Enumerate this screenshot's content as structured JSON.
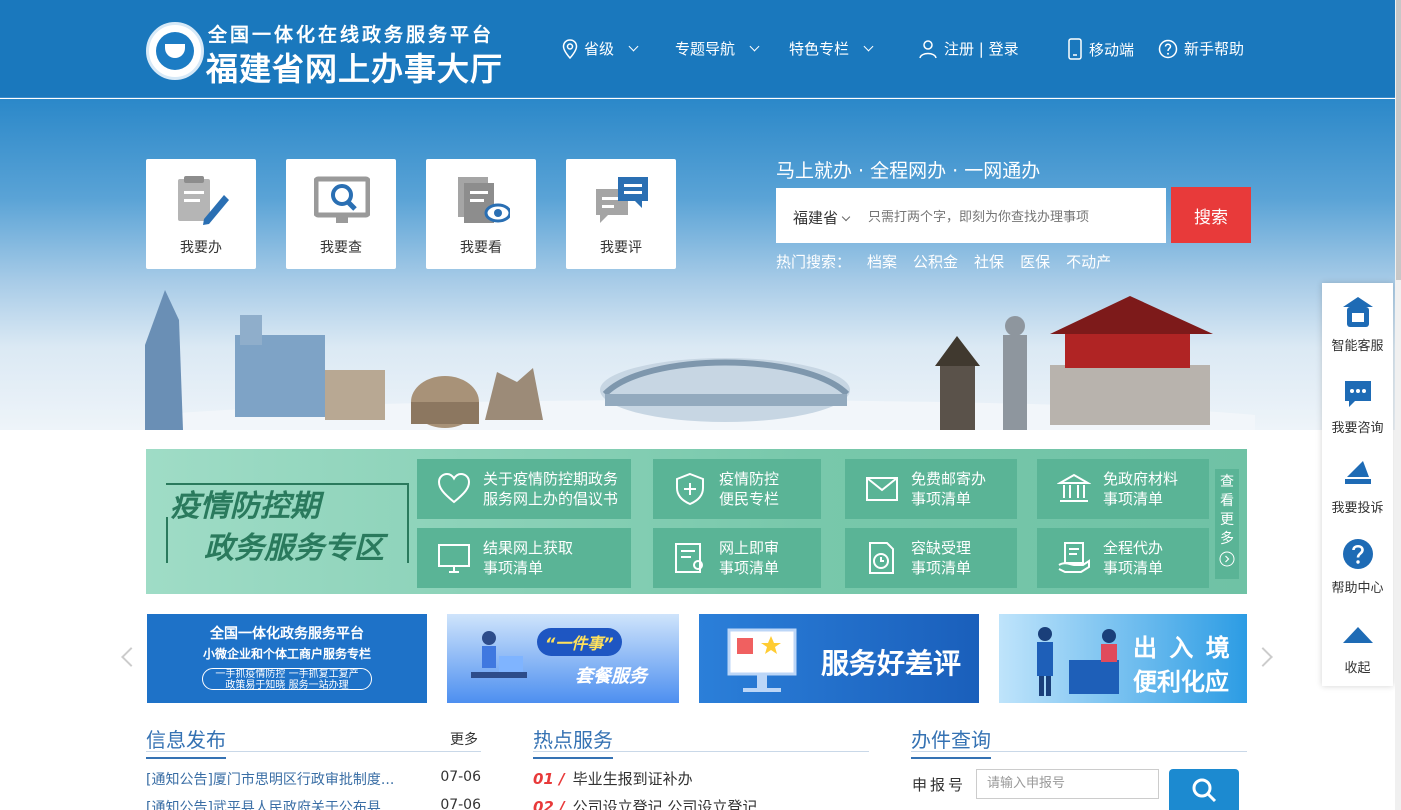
{
  "header": {
    "brand_sub": "全国一体化在线政务服务平台",
    "brand_main": "福建省网上办事大厅",
    "nav": {
      "province": "省级",
      "topics": "专题导航",
      "special": "特色专栏",
      "register_login": "注册 | 登录",
      "mobile": "移动端",
      "help": "新手帮助"
    }
  },
  "hero": {
    "tiles": [
      "我要办",
      "我要查",
      "我要看",
      "我要评"
    ],
    "slogan": "马上就办 · 全程网办 · 一网通办",
    "search": {
      "province": "福建省",
      "placeholder": "只需打两个字，即刻为你查找办理事项",
      "button": "搜索"
    },
    "hot_label": "热门搜索：",
    "hot_terms": [
      "档案",
      "公积金",
      "社保",
      "医保",
      "不动产"
    ]
  },
  "covid": {
    "title1": "疫情防控期",
    "title2": "政务服务专区",
    "items": [
      {
        "line1": "关于疫情防控期政务",
        "line2": "服务网上办的倡议书"
      },
      {
        "line1": "疫情防控",
        "line2": "便民专栏"
      },
      {
        "line1": "免费邮寄办",
        "line2": "事项清单"
      },
      {
        "line1": "免政府材料",
        "line2": "事项清单"
      },
      {
        "line1": "结果网上获取",
        "line2": "事项清单"
      },
      {
        "line1": "网上即审",
        "line2": "事项清单"
      },
      {
        "line1": "容缺受理",
        "line2": "事项清单"
      },
      {
        "line1": "全程代办",
        "line2": "事项清单"
      }
    ],
    "more": [
      "查",
      "看",
      "更",
      "多"
    ]
  },
  "banners": {
    "b1": {
      "line1": "全国一体化政务服务平台",
      "line2": "小微企业和个体工商户服务专栏",
      "line3": "一手抓疫情防控 一手抓复工复产",
      "line4": "政策易于知晓 服务一站办理"
    },
    "b2": {
      "line1": "“一件事”",
      "line2": "套餐服务"
    },
    "b3": {
      "line1": "服务好差评"
    },
    "b4": {
      "line1": "出 入 境",
      "line2": "便利化应用"
    }
  },
  "info": {
    "title": "信息发布",
    "more": "更多",
    "items": [
      {
        "text": "[通知公告]厦门市思明区行政审批制度...",
        "date": "07-06"
      },
      {
        "text": "[通知公告]武平县人民政府关于公布县...",
        "date": "07-06"
      }
    ]
  },
  "hot_services": {
    "title": "热点服务",
    "items": [
      {
        "num": "01 /",
        "text": "毕业生报到证补办"
      },
      {
        "num": "02 /",
        "text": "公司设立登记  公司设立登记"
      }
    ]
  },
  "query": {
    "title": "办件查询",
    "label": "申报号",
    "placeholder": "请输入申报号"
  },
  "float_bar": [
    "智能客服",
    "我要咨询",
    "我要投诉",
    "帮助中心",
    "收起"
  ],
  "colors": {
    "header_blue": "#1a78bd",
    "search_red": "#e83a3a",
    "covid_green": "#5ab496",
    "section_blue": "#3572b3"
  }
}
